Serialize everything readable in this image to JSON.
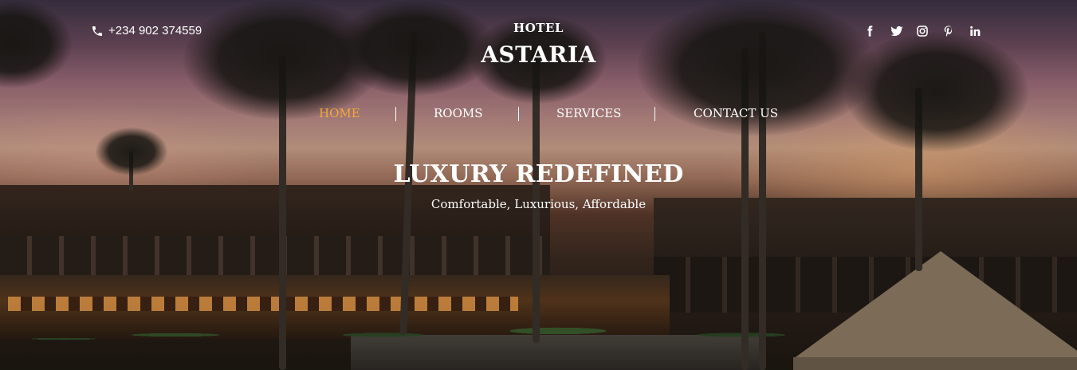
{
  "header": {
    "phone": "+234 902 374559",
    "brand_top": "HOTEL",
    "brand_main": "ASTARIA",
    "social_icons": [
      "facebook-icon",
      "twitter-icon",
      "instagram-icon",
      "pinterest-icon",
      "linkedin-icon"
    ]
  },
  "nav": {
    "items": [
      {
        "label": "HOME",
        "active": true
      },
      {
        "label": "ROOMS",
        "active": false
      },
      {
        "label": "SERVICES",
        "active": false
      },
      {
        "label": "CONTACT US",
        "active": false
      }
    ],
    "active_color": "#f2a93b"
  },
  "hero": {
    "headline": "LUXURY REDEFINED",
    "tagline": "Comfortable, Luxurious, Affordable"
  }
}
